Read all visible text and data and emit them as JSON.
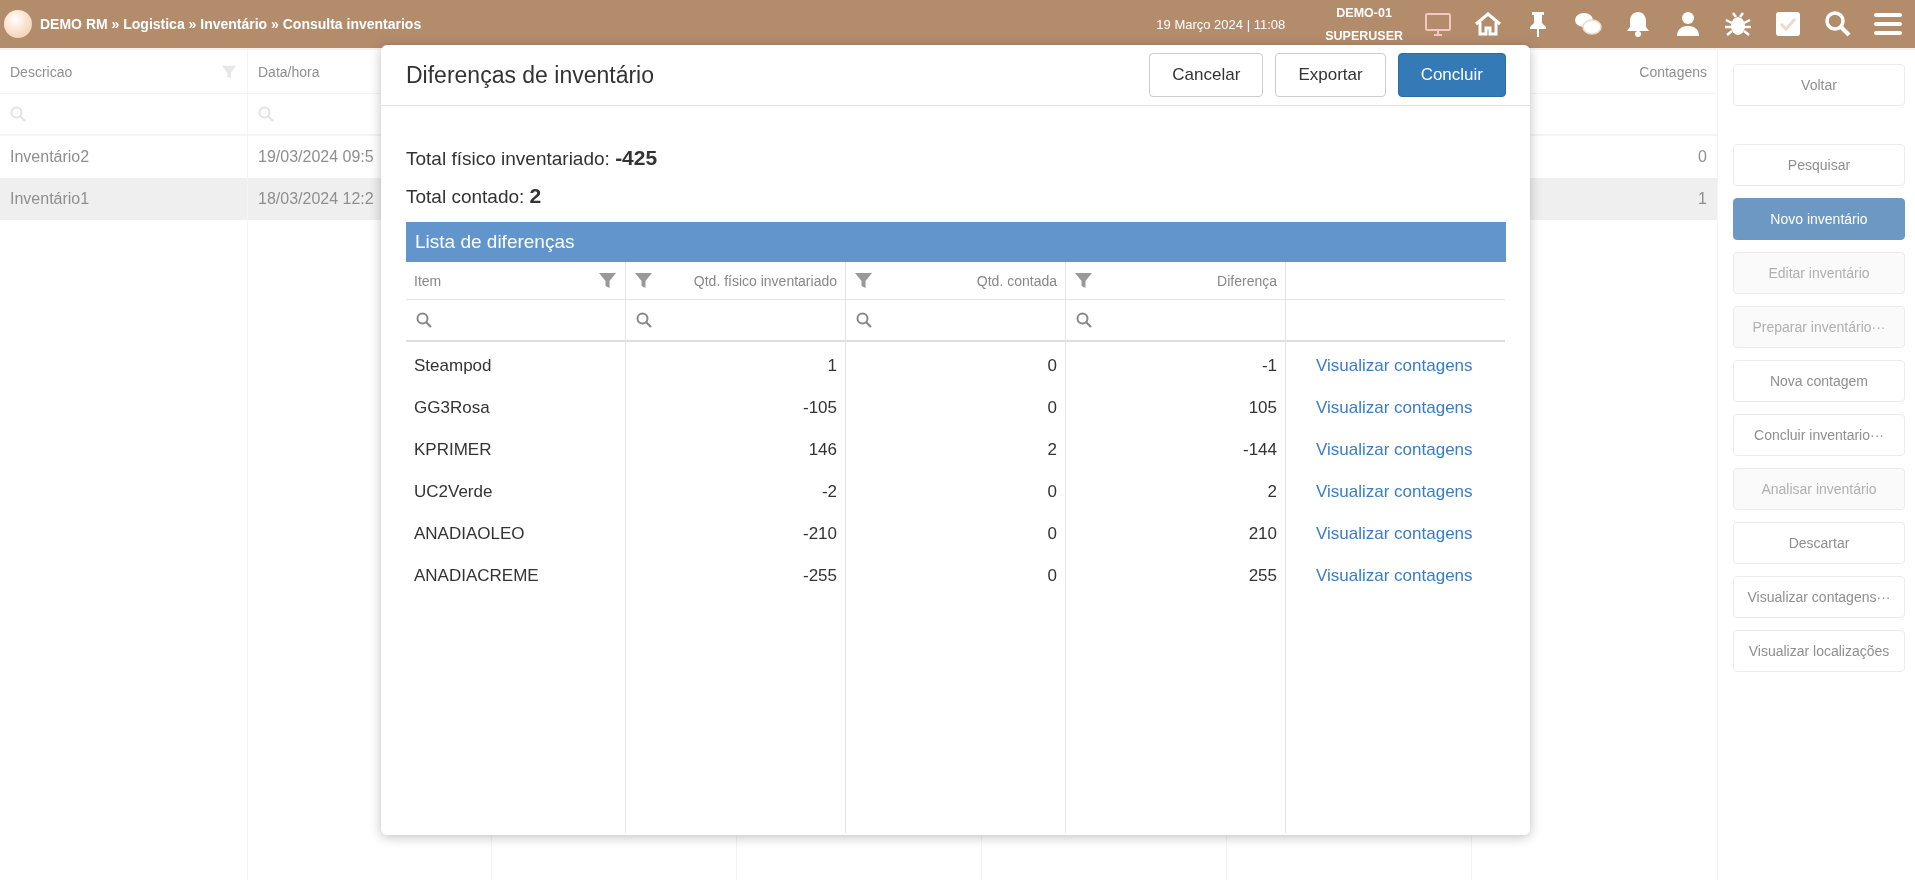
{
  "topbar": {
    "breadcrumb": "DEMO RM » Logistica » Inventário » Consulta inventarios",
    "datetime": "19 Março 2024 | 11:08",
    "company": "DEMO-01",
    "user": "SUPERUSER",
    "icons": [
      {
        "kind": "monitor"
      },
      {
        "kind": "home"
      },
      {
        "kind": "pin"
      },
      {
        "kind": "chat"
      },
      {
        "kind": "bell"
      },
      {
        "kind": "user"
      },
      {
        "kind": "bug"
      },
      {
        "kind": "check"
      },
      {
        "kind": "search"
      },
      {
        "kind": "menu"
      }
    ]
  },
  "background_table": {
    "columns": [
      "Descricao",
      "Data/hora",
      "Contagens"
    ],
    "rows": [
      {
        "description": "Inventário2",
        "date_time": "19/03/2024 09:5",
        "contagens": "0",
        "selected": false
      },
      {
        "description": "Inventário1",
        "date_time": "18/03/2024 12:2",
        "contagens": "1",
        "selected": true
      }
    ]
  },
  "sidebar": {
    "buttons": [
      {
        "label": "Voltar",
        "disabled": false,
        "primary": false
      },
      {
        "label": "Pesquisar",
        "disabled": false,
        "primary": false
      },
      {
        "label": "Novo inventário",
        "disabled": false,
        "primary": true
      },
      {
        "label": "Editar inventário",
        "disabled": true,
        "primary": false
      },
      {
        "label": "Preparar inventário···",
        "disabled": true,
        "primary": false
      },
      {
        "label": "Nova contagem",
        "disabled": false,
        "primary": false
      },
      {
        "label": "Concluir inventario···",
        "disabled": false,
        "primary": false
      },
      {
        "label": "Analisar inventário",
        "disabled": true,
        "primary": false
      },
      {
        "label": "Descartar",
        "disabled": false,
        "primary": false
      },
      {
        "label": "Visualizar contagens···",
        "disabled": false,
        "primary": false
      },
      {
        "label": "Visualizar localizações",
        "disabled": false,
        "primary": false
      }
    ]
  },
  "dialog": {
    "title": "Diferenças de inventário",
    "buttons": [
      {
        "label": "Cancelar",
        "primary": false
      },
      {
        "label": "Exportar",
        "primary": false
      },
      {
        "label": "Concluir",
        "primary": true
      }
    ],
    "totals": [
      "Total físico inventariado: **-425**",
      "Total contado: **2**"
    ],
    "list_title": "Lista de diferenças",
    "columns": [
      {
        "label": "Item",
        "kind": "text"
      },
      {
        "label": "Qtd. físico inventariado",
        "kind": "number"
      },
      {
        "label": "Qtd. contada",
        "kind": "number"
      },
      {
        "label": "Diferença",
        "kind": "number"
      }
    ],
    "rows": [
      {
        "cells": [
          "Steampod",
          "1",
          "0",
          "-1"
        ],
        "action": "Visualizar contagens"
      },
      {
        "cells": [
          "GG3Rosa",
          "-105",
          "0",
          "105"
        ],
        "action": "Visualizar contagens"
      },
      {
        "cells": [
          "KPRIMER",
          "146",
          "2",
          "-144"
        ],
        "action": "Visualizar contagens"
      },
      {
        "cells": [
          "UC2Verde",
          "-2",
          "0",
          "2"
        ],
        "action": "Visualizar contagens"
      },
      {
        "cells": [
          "ANADIAOLEO",
          "-210",
          "0",
          "210"
        ],
        "action": "Visualizar contagens"
      },
      {
        "cells": [
          "ANADIACREME",
          "-255",
          "0",
          "255"
        ],
        "action": "Visualizar contagens"
      }
    ]
  }
}
